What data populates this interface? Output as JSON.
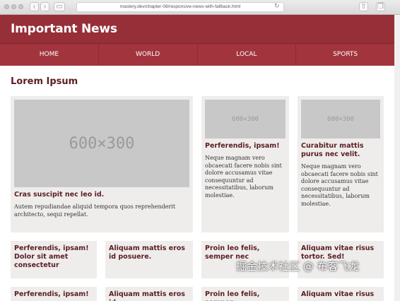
{
  "browser": {
    "url": "mastery.dev/chapter-08/responsive-news-with-fallback.html"
  },
  "site": {
    "title": "Important News"
  },
  "nav": [
    "HOME",
    "WORLD",
    "LOCAL",
    "SPORTS"
  ],
  "section": {
    "title": "Lorem Ipsum"
  },
  "featured": [
    {
      "image": "600×300",
      "title": "Cras suscipit nec leo id.",
      "text": "Autem repudiandae aliquid tempora quos reprehenderit architecto, sequi repellat."
    },
    {
      "image": "600×300",
      "title": "Perferendis, ipsam!",
      "text": "Neque magnam vero obcaecati facere nobis sint dolore accusamus vitae consequuntur ad necessitatibus, laborum molestiae."
    },
    {
      "image": "600×300",
      "title": "Curabitur mattis purus nec velit.",
      "text": "Neque magnam vero obcaecati facere nobis sint dolore accusamus vitae consequuntur ad necessitatibus, laborum molestiae."
    }
  ],
  "row2": [
    "Perferendis, ipsam! Dolor sit amet consectetur",
    "Aliquam mattis eros id posuere.",
    "Proin leo felis, semper nec",
    "Aliquam vitae risus tortor. Sed!"
  ],
  "row3": [
    "Perferendis, ipsam!",
    "Aliquam mattis eros id",
    "Proin leo felis, semper",
    "Aliquam vitae risus"
  ],
  "watermark": "掘金技术社区 @ 布客飞龙"
}
